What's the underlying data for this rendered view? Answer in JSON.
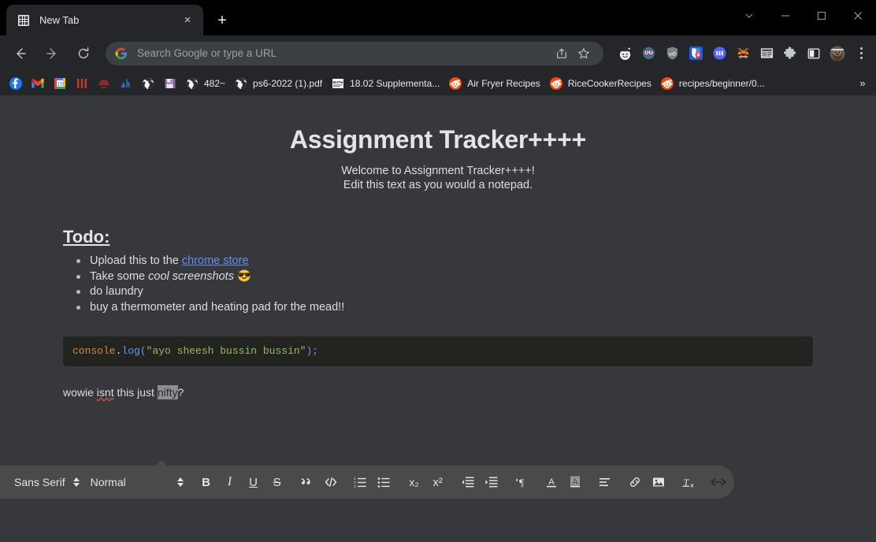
{
  "window": {
    "controls": [
      {
        "name": "tab-search-chevron",
        "glyph": "chevron-down-icon"
      },
      {
        "name": "minimize",
        "glyph": "minimize-icon"
      },
      {
        "name": "maximize",
        "glyph": "maximize-icon"
      },
      {
        "name": "close",
        "glyph": "close-icon"
      }
    ]
  },
  "tabs": [
    {
      "title": "New Tab",
      "favicon": "grid-icon",
      "active": true
    }
  ],
  "newtab_label": "+",
  "tab_close_label": "×",
  "omnibox": {
    "placeholder": "Search Google or type a URL",
    "value": "",
    "leading_icon": "google-g-icon",
    "share_icon": "share-icon",
    "bookmark_icon": "star-icon"
  },
  "nav": {
    "back": "←",
    "forward": "→",
    "reload": "⟳"
  },
  "extensions": [
    {
      "name": "reddit-enhancement-extension",
      "color": "#e8e8e8"
    },
    {
      "name": "owl-extension",
      "color": "#4a6a86"
    },
    {
      "name": "ublock-origin-extension",
      "color": "#7a8288"
    },
    {
      "name": "bitwarden-extension",
      "color": "#175ddc"
    },
    {
      "name": "pocket-casts-extension",
      "color": "#5662f6"
    },
    {
      "name": "metamask-extension",
      "color": "#e2761b"
    },
    {
      "name": "news-reader-extension",
      "color": "#d9d9d9"
    },
    {
      "name": "extensions-puzzle-icon",
      "color": "#c4c7ca"
    },
    {
      "name": "side-panel-icon",
      "color": "#ffffff"
    },
    {
      "name": "profile-avatar",
      "color": "#6b5a43"
    }
  ],
  "bookmarks": [
    {
      "label": "",
      "icon": "facebook-icon",
      "icon_only": true
    },
    {
      "label": "",
      "icon": "gmail-icon",
      "icon_only": true
    },
    {
      "label": "",
      "icon": "google-calendar-icon",
      "icon_only": true
    },
    {
      "label": "",
      "icon": "red-bars-icon",
      "icon_only": true
    },
    {
      "label": "",
      "icon": "mit-icon",
      "icon_only": true
    },
    {
      "label": "",
      "icon": "blue-chart-icon",
      "icon_only": true
    },
    {
      "label": "",
      "icon": "globe-icon",
      "icon_only": true
    },
    {
      "label": "",
      "icon": "floppy-disk-icon",
      "icon_only": true
    },
    {
      "label": "482~",
      "icon": "globe-icon",
      "icon_only": false
    },
    {
      "label": "ps6-2022 (1).pdf",
      "icon": "globe-icon",
      "icon_only": false
    },
    {
      "label": "18.02 Supplementa...",
      "icon": "math-icon",
      "icon_only": false
    },
    {
      "label": "Air Fryer Recipes",
      "icon": "reddit-icon",
      "icon_only": false
    },
    {
      "label": "RiceCookerRecipes",
      "icon": "reddit-icon",
      "icon_only": false
    },
    {
      "label": "recipes/beginner/0...",
      "icon": "reddit-icon",
      "icon_only": false
    }
  ],
  "bookmarks_overflow_label": "»",
  "document": {
    "title": "Assignment Tracker++++",
    "welcome_line_1": "Welcome to Assignment Tracker++++!",
    "welcome_line_2": "Edit this text as you would a notepad.",
    "todo_heading": "Todo:",
    "todo_items": [
      {
        "prefix": "Upload this to the ",
        "link": "chrome store",
        "suffix": ""
      },
      {
        "prefix": "Take some ",
        "italic": "cool screenshots",
        "suffix": " 😎"
      },
      {
        "prefix": "do laundry",
        "suffix": ""
      },
      {
        "prefix": "buy a thermometer and heating pad for the mead!!",
        "suffix": ""
      }
    ],
    "code": {
      "object": "console",
      "dot": ".",
      "method": "log",
      "open_paren": "(",
      "string": "\"ayo sheesh bussin bussin\"",
      "close": ");"
    },
    "paragraph": {
      "before": "wowie ",
      "misspelled": "isnt",
      "middle": " this just ",
      "selected": "nifty",
      "after": "?"
    }
  },
  "editor_toolbar": {
    "font_family": "Sans Serif",
    "font_size": "Normal",
    "buttons": [
      {
        "name": "bold-button",
        "label": "B"
      },
      {
        "name": "italic-button",
        "label": "I"
      },
      {
        "name": "underline-button",
        "label": "U"
      },
      {
        "name": "strikethrough-button",
        "label": "S"
      },
      {
        "name": "blockquote-button",
        "label": "”"
      },
      {
        "name": "code-block-button",
        "label": "</>"
      },
      {
        "name": "ordered-list-button",
        "label": "ordered-list-icon"
      },
      {
        "name": "bullet-list-button",
        "label": "bullet-list-icon"
      },
      {
        "name": "subscript-button",
        "label": "x₂"
      },
      {
        "name": "superscript-button",
        "label": "x²"
      },
      {
        "name": "outdent-button",
        "label": "outdent-icon"
      },
      {
        "name": "indent-button",
        "label": "indent-icon"
      },
      {
        "name": "text-direction-button",
        "label": "¶"
      },
      {
        "name": "text-color-button",
        "label": "A"
      },
      {
        "name": "highlight-color-button",
        "label": "A"
      },
      {
        "name": "align-button",
        "label": "align-icon"
      },
      {
        "name": "link-button",
        "label": "link-icon"
      },
      {
        "name": "image-button",
        "label": "image-icon"
      },
      {
        "name": "clear-formatting-button",
        "label": "Tx"
      },
      {
        "name": "source-code-button",
        "label": "<>"
      }
    ]
  },
  "colors": {
    "page_background": "#36383c",
    "chrome_background": "#25262a",
    "titlebar_background": "#000000",
    "code_background": "#23241f",
    "toolbar_background": "#4a4a4a",
    "link": "#5f8ff0",
    "selection": "#8d8f92",
    "spellcheck_underline": "#e04a4a"
  }
}
